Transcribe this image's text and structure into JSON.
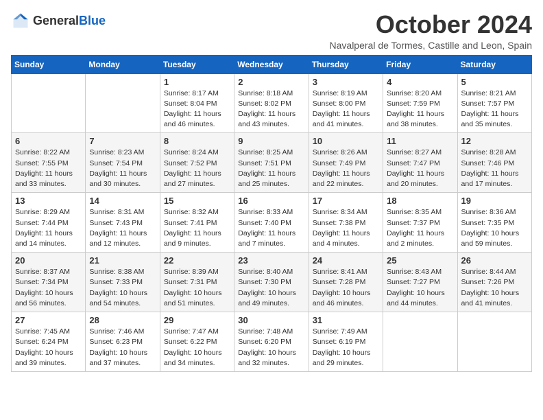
{
  "header": {
    "logo_general": "General",
    "logo_blue": "Blue",
    "title": "October 2024",
    "subtitle": "Navalperal de Tormes, Castille and Leon, Spain"
  },
  "weekdays": [
    "Sunday",
    "Monday",
    "Tuesday",
    "Wednesday",
    "Thursday",
    "Friday",
    "Saturday"
  ],
  "weeks": [
    [
      {
        "day": "",
        "info": ""
      },
      {
        "day": "",
        "info": ""
      },
      {
        "day": "1",
        "info": "Sunrise: 8:17 AM\nSunset: 8:04 PM\nDaylight: 11 hours and 46 minutes."
      },
      {
        "day": "2",
        "info": "Sunrise: 8:18 AM\nSunset: 8:02 PM\nDaylight: 11 hours and 43 minutes."
      },
      {
        "day": "3",
        "info": "Sunrise: 8:19 AM\nSunset: 8:00 PM\nDaylight: 11 hours and 41 minutes."
      },
      {
        "day": "4",
        "info": "Sunrise: 8:20 AM\nSunset: 7:59 PM\nDaylight: 11 hours and 38 minutes."
      },
      {
        "day": "5",
        "info": "Sunrise: 8:21 AM\nSunset: 7:57 PM\nDaylight: 11 hours and 35 minutes."
      }
    ],
    [
      {
        "day": "6",
        "info": "Sunrise: 8:22 AM\nSunset: 7:55 PM\nDaylight: 11 hours and 33 minutes."
      },
      {
        "day": "7",
        "info": "Sunrise: 8:23 AM\nSunset: 7:54 PM\nDaylight: 11 hours and 30 minutes."
      },
      {
        "day": "8",
        "info": "Sunrise: 8:24 AM\nSunset: 7:52 PM\nDaylight: 11 hours and 27 minutes."
      },
      {
        "day": "9",
        "info": "Sunrise: 8:25 AM\nSunset: 7:51 PM\nDaylight: 11 hours and 25 minutes."
      },
      {
        "day": "10",
        "info": "Sunrise: 8:26 AM\nSunset: 7:49 PM\nDaylight: 11 hours and 22 minutes."
      },
      {
        "day": "11",
        "info": "Sunrise: 8:27 AM\nSunset: 7:47 PM\nDaylight: 11 hours and 20 minutes."
      },
      {
        "day": "12",
        "info": "Sunrise: 8:28 AM\nSunset: 7:46 PM\nDaylight: 11 hours and 17 minutes."
      }
    ],
    [
      {
        "day": "13",
        "info": "Sunrise: 8:29 AM\nSunset: 7:44 PM\nDaylight: 11 hours and 14 minutes."
      },
      {
        "day": "14",
        "info": "Sunrise: 8:31 AM\nSunset: 7:43 PM\nDaylight: 11 hours and 12 minutes."
      },
      {
        "day": "15",
        "info": "Sunrise: 8:32 AM\nSunset: 7:41 PM\nDaylight: 11 hours and 9 minutes."
      },
      {
        "day": "16",
        "info": "Sunrise: 8:33 AM\nSunset: 7:40 PM\nDaylight: 11 hours and 7 minutes."
      },
      {
        "day": "17",
        "info": "Sunrise: 8:34 AM\nSunset: 7:38 PM\nDaylight: 11 hours and 4 minutes."
      },
      {
        "day": "18",
        "info": "Sunrise: 8:35 AM\nSunset: 7:37 PM\nDaylight: 11 hours and 2 minutes."
      },
      {
        "day": "19",
        "info": "Sunrise: 8:36 AM\nSunset: 7:35 PM\nDaylight: 10 hours and 59 minutes."
      }
    ],
    [
      {
        "day": "20",
        "info": "Sunrise: 8:37 AM\nSunset: 7:34 PM\nDaylight: 10 hours and 56 minutes."
      },
      {
        "day": "21",
        "info": "Sunrise: 8:38 AM\nSunset: 7:33 PM\nDaylight: 10 hours and 54 minutes."
      },
      {
        "day": "22",
        "info": "Sunrise: 8:39 AM\nSunset: 7:31 PM\nDaylight: 10 hours and 51 minutes."
      },
      {
        "day": "23",
        "info": "Sunrise: 8:40 AM\nSunset: 7:30 PM\nDaylight: 10 hours and 49 minutes."
      },
      {
        "day": "24",
        "info": "Sunrise: 8:41 AM\nSunset: 7:28 PM\nDaylight: 10 hours and 46 minutes."
      },
      {
        "day": "25",
        "info": "Sunrise: 8:43 AM\nSunset: 7:27 PM\nDaylight: 10 hours and 44 minutes."
      },
      {
        "day": "26",
        "info": "Sunrise: 8:44 AM\nSunset: 7:26 PM\nDaylight: 10 hours and 41 minutes."
      }
    ],
    [
      {
        "day": "27",
        "info": "Sunrise: 7:45 AM\nSunset: 6:24 PM\nDaylight: 10 hours and 39 minutes."
      },
      {
        "day": "28",
        "info": "Sunrise: 7:46 AM\nSunset: 6:23 PM\nDaylight: 10 hours and 37 minutes."
      },
      {
        "day": "29",
        "info": "Sunrise: 7:47 AM\nSunset: 6:22 PM\nDaylight: 10 hours and 34 minutes."
      },
      {
        "day": "30",
        "info": "Sunrise: 7:48 AM\nSunset: 6:20 PM\nDaylight: 10 hours and 32 minutes."
      },
      {
        "day": "31",
        "info": "Sunrise: 7:49 AM\nSunset: 6:19 PM\nDaylight: 10 hours and 29 minutes."
      },
      {
        "day": "",
        "info": ""
      },
      {
        "day": "",
        "info": ""
      }
    ]
  ]
}
